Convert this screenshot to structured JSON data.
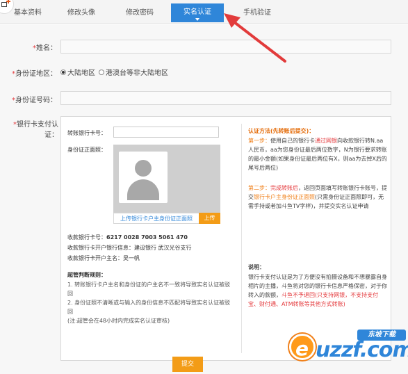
{
  "tabs": [
    {
      "label": "基本资料",
      "active": false
    },
    {
      "label": "修改头像",
      "active": false
    },
    {
      "label": "修改密码",
      "active": false
    },
    {
      "label": "实名认证",
      "active": true
    },
    {
      "label": "手机验证",
      "active": false
    }
  ],
  "form": {
    "name_label": "姓名：",
    "region_label": "身份证地区：",
    "region_options": [
      "大陆地区",
      "港澳台等非大陆地区"
    ],
    "region_selected": "大陆地区",
    "id_label": "身份证号码：",
    "card_label": "银行卡支付认证：",
    "required_mark": "*"
  },
  "card_panel": {
    "card_no_label": "转账银行卡号：",
    "id_photo_label": "身份证正面照：",
    "upload_link": "上传银行卡户主身份证正面照",
    "upload_button": "上传",
    "receive_card_label": "收款银行卡号：",
    "receive_card_value": "6217 0028 7003 5061 470",
    "receive_bank_label": "收款银行卡开户银行信息：",
    "receive_bank_value": "建设银行 武汉光谷支行",
    "receive_owner_label": "收款银行卡开户主名：",
    "receive_owner_value": "吴一帆",
    "rules_title": "超管判断规则：",
    "rules": [
      "1. 转账银行卡户主名和身份证的户主名不一致将导致实名认证被驳回",
      "2. 身份证照不清晰或与输入的身份信息不匹配将导致实名认证被驳回",
      "(注:超管会在48小时内完成实名认证审核)"
    ]
  },
  "method": {
    "title": "认证方法(先转账后提交)：",
    "step1_title": "第一步：",
    "step1_a": "使用自己的银行卡",
    "step1_link": "通过网银",
    "step1_b": "向收款银行转N.aa人民币，aa为您身份证最后两位数字，N为银行要求转账的最小金额(如果身份证最后两位有X，则aa为去掉X后的尾号后两位)",
    "step2_title": "第二步：",
    "step2_link": "完成转账后",
    "step2_a": "，返回页面填写转账银行卡账号，提交",
    "step2_link2": "银行卡户主身份证正面照",
    "step2_b": "(只需身份证正面照即可，无需手持或者加斗鱼TV字样)，并提交实名认证申请",
    "note_title": "说明：",
    "note_a": "银行卡支付认证是为了方便没有拍摄设备和不想暴露自身相片的主播，斗鱼将对您的银行卡信息严格保密，对于你转入的款额，",
    "note_red": "斗鱼不予退回(只支持网银，不支持支付宝、财付通、ATM转账等其他方式转账)"
  },
  "submit_label": "提交",
  "watermark": {
    "text": "uzzf.com",
    "tag": "东坡下载"
  },
  "colors": {
    "accent": "#2f86d9",
    "orange": "#f39c17",
    "required": "#e4393c",
    "arrow": "#e23b3b"
  }
}
